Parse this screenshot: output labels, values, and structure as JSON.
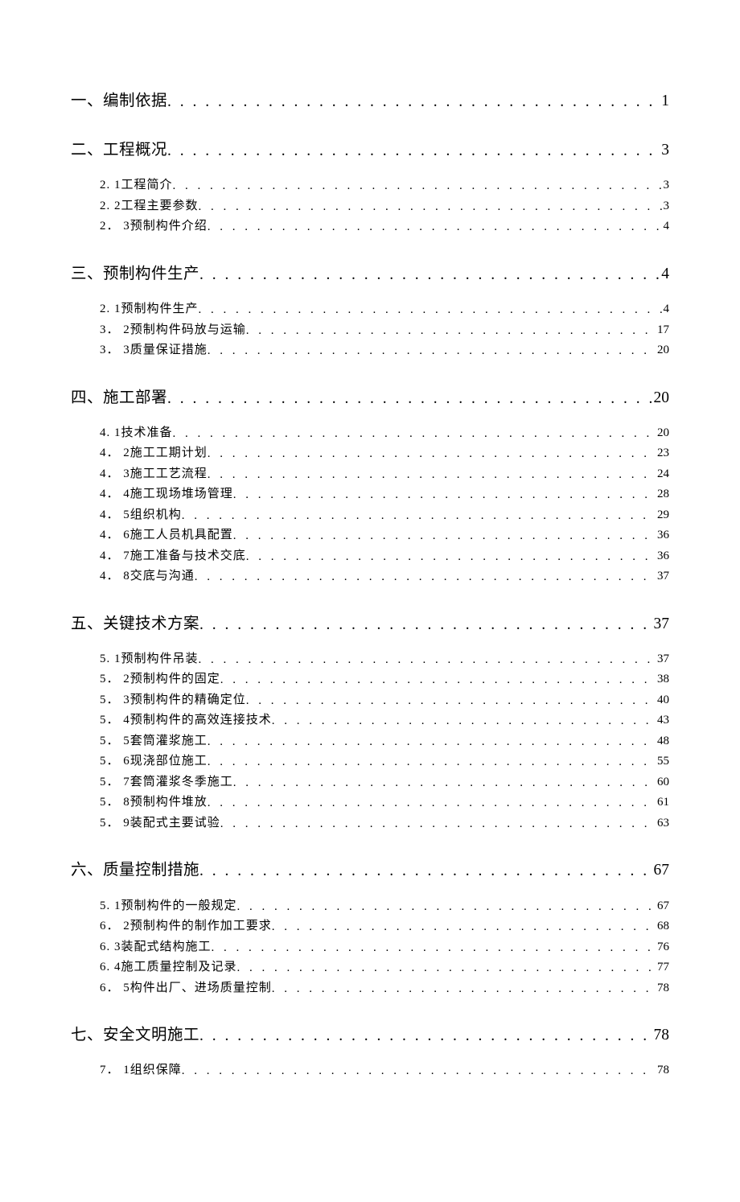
{
  "toc": [
    {
      "num": "一、",
      "title": "编制依据",
      "page": "1",
      "subs": []
    },
    {
      "num": "二、",
      "title": "工程概况",
      "page": "3",
      "subs": [
        {
          "num": "2. 1",
          "title": " 工程简介",
          "page": "3"
        },
        {
          "num": "2. 2",
          "title": " 工程主要参数",
          "page": "3"
        },
        {
          "num": "2． 3",
          "title": " 预制构件介绍",
          "page": "4"
        }
      ]
    },
    {
      "num": "三、",
      "title": "预制构件生产",
      "page": "4",
      "subs": [
        {
          "num": "2. 1",
          "title": "  预制构件生产",
          "page": "4"
        },
        {
          "num": "3． 2",
          "title": " 预制构件码放与运输",
          "page": "17"
        },
        {
          "num": "3． 3",
          "title": " 质量保证措施",
          "page": "20"
        }
      ]
    },
    {
      "num": "四、",
      "title": "施工部署",
      "page": "20",
      "subs": [
        {
          "num": "4. 1",
          "title": " 技术准备",
          "page": "20"
        },
        {
          "num": "4． 2",
          "title": " 施工工期计划",
          "page": "23"
        },
        {
          "num": "4． 3",
          "title": " 施工工艺流程",
          "page": "24"
        },
        {
          "num": "4． 4",
          "title": " 施工现场堆场管理",
          "page": "28"
        },
        {
          "num": "4． 5",
          "title": " 组织机构",
          "page": "29"
        },
        {
          "num": "4． 6",
          "title": " 施工人员机具配置",
          "page": "36"
        },
        {
          "num": "4． 7",
          "title": " 施工准备与技术交底",
          "page": "36"
        },
        {
          "num": "4． 8",
          "title": " 交底与沟通",
          "page": "37"
        }
      ]
    },
    {
      "num": "五、",
      "title": "关键技术方案",
      "page": "37",
      "subs": [
        {
          "num": "5. 1",
          "title": " 预制构件吊装",
          "page": "37"
        },
        {
          "num": "5． 2",
          "title": " 预制构件的固定",
          "page": "38"
        },
        {
          "num": "5． 3",
          "title": " 预制构件的精确定位",
          "page": "40"
        },
        {
          "num": "5． 4",
          "title": " 预制构件的高效连接技术",
          "page": "43"
        },
        {
          "num": "5． 5",
          "title": " 套筒灌浆施工",
          "page": "48"
        },
        {
          "num": "5． 6",
          "title": " 现浇部位施工",
          "page": "55"
        },
        {
          "num": "5． 7",
          "title": " 套筒灌浆冬季施工",
          "page": "60"
        },
        {
          "num": "5． 8",
          "title": " 预制构件堆放",
          "page": "61"
        },
        {
          "num": "5． 9",
          "title": " 装配式主要试验",
          "page": "63"
        }
      ]
    },
    {
      "num": "六、",
      "title": "质量控制措施",
      "page": "67",
      "subs": [
        {
          "num": "5. 1",
          "title": "  预制构件的一般规定",
          "page": "67"
        },
        {
          "num": "6． 2",
          "title": " 预制构件的制作加工要求",
          "page": "68"
        },
        {
          "num": "6. 3",
          "title": " 装配式结构施工",
          "page": "76"
        },
        {
          "num": "6. 4",
          "title": " 施工质量控制及记录",
          "page": "77"
        },
        {
          "num": "6． 5",
          "title": " 构件出厂、进场质量控制",
          "page": "78"
        }
      ]
    },
    {
      "num": "七、",
      "title": "安全文明施工",
      "page": "78",
      "subs": [
        {
          "num": "7． 1",
          "title": " 组织保障",
          "page": "78"
        }
      ]
    }
  ]
}
